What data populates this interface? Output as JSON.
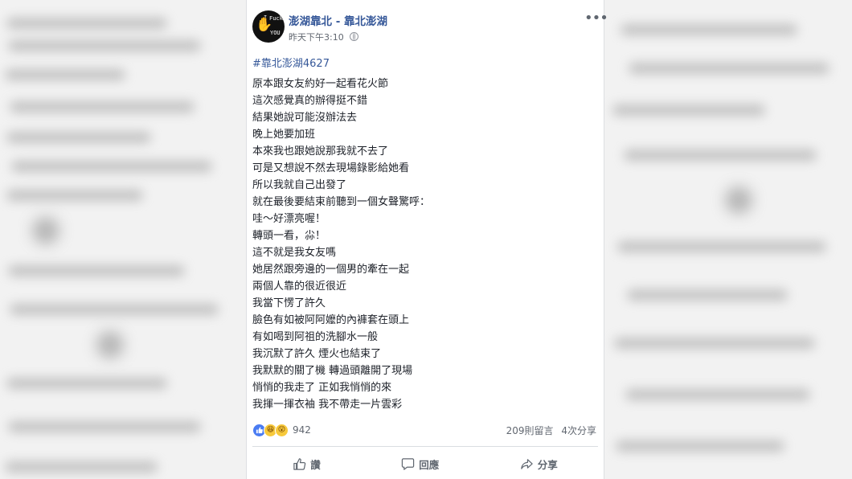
{
  "post": {
    "page_name": "澎湖靠北 - 靠北澎湖",
    "timestamp": "昨天下午3:10",
    "hashtag": "#靠北澎湖4627",
    "body_lines": [
      "原本跟女友約好一起看花火節",
      "這次感覺真的辦得挺不錯",
      "結果她說可能沒辦法去",
      "晚上她要加班",
      "本來我也跟她說那我就不去了",
      "可是又想說不然去現場錄影給她看",
      "所以我就自己出發了",
      "就在最後要結束前聽到一個女聲驚呼：",
      "哇～好漂亮喔！",
      "轉頭一看，尛！",
      "這不就是我女友嗎",
      "她居然跟旁邊的一個男的牽在一起",
      "兩個人靠的很近很近",
      "我當下愣了許久",
      "臉色有如被阿阿嬤的內褲套在頭上",
      "有如喝到阿祖的洗腳水一般",
      "我沉默了許久 煙火也結束了",
      "我默默的關了機 轉過頭離開了現場",
      "悄悄的我走了 正如我悄悄的來",
      "我揮一揮衣袖 我不帶走一片雲彩"
    ],
    "reactions": {
      "icons": [
        "like-icon",
        "haha-icon",
        "wow-icon"
      ],
      "count": "942"
    },
    "comments": "209則留言",
    "shares": "4次分享",
    "actions": {
      "like": "讚",
      "comment": "回應",
      "share": "分享"
    },
    "colors": {
      "link": "#365899",
      "text": "#1d2129",
      "muted": "#616770",
      "like_blue": "#4a7cf2",
      "emoji_yellow": "#f7c93b"
    }
  }
}
